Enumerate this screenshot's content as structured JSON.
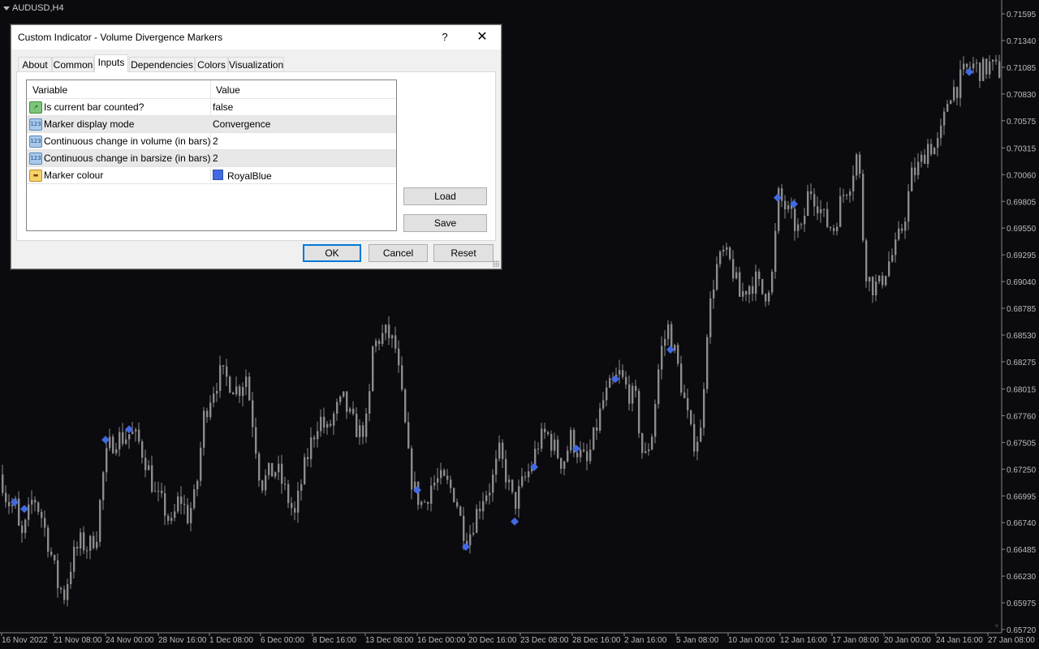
{
  "chart": {
    "symbol": "AUDUSD,H4",
    "background": "#0a0a0f",
    "candle_color": "#8c8c8c",
    "marker_color": "#4169E1",
    "price_axis": [
      "0.71595",
      "0.71340",
      "0.71085",
      "0.70830",
      "0.70575",
      "0.70315",
      "0.70060",
      "0.69805",
      "0.69550",
      "0.69295",
      "0.69040",
      "0.68785",
      "0.68530",
      "0.68275",
      "0.68015",
      "0.67760",
      "0.67505",
      "0.67250",
      "0.66995",
      "0.66740",
      "0.66485",
      "0.66230",
      "0.65975",
      "0.65720"
    ],
    "time_axis": [
      "16 Nov 2022",
      "21 Nov 08:00",
      "24 Nov 00:00",
      "28 Nov 16:00",
      "1 Dec 08:00",
      "6 Dec 00:00",
      "8 Dec 16:00",
      "13 Dec 08:00",
      "16 Dec 00:00",
      "20 Dec 16:00",
      "23 Dec 08:00",
      "28 Dec 16:00",
      "2 Jan 16:00",
      "5 Jan 08:00",
      "10 Jan 00:00",
      "12 Jan 16:00",
      "17 Jan 08:00",
      "20 Jan 00:00",
      "24 Jan 16:00",
      "27 Jan 08:00"
    ],
    "ylim": [
      0.6572,
      0.7172
    ],
    "close_path": [
      [
        0,
        0.672
      ],
      [
        6,
        0.67
      ],
      [
        12,
        0.669
      ],
      [
        18,
        0.669
      ],
      [
        24,
        0.6655
      ],
      [
        30,
        0.667
      ],
      [
        40,
        0.67
      ],
      [
        50,
        0.668
      ],
      [
        60,
        0.665
      ],
      [
        70,
        0.6615
      ],
      [
        78,
        0.6605
      ],
      [
        88,
        0.664
      ],
      [
        98,
        0.6655
      ],
      [
        108,
        0.665
      ],
      [
        118,
        0.6665
      ],
      [
        126,
        0.672
      ],
      [
        132,
        0.6745
      ],
      [
        142,
        0.6755
      ],
      [
        152,
        0.6755
      ],
      [
        160,
        0.676
      ],
      [
        170,
        0.675
      ],
      [
        180,
        0.673
      ],
      [
        190,
        0.67
      ],
      [
        200,
        0.669
      ],
      [
        210,
        0.667
      ],
      [
        220,
        0.67
      ],
      [
        230,
        0.668
      ],
      [
        240,
        0.67
      ],
      [
        250,
        0.6775
      ],
      [
        260,
        0.68
      ],
      [
        270,
        0.6815
      ],
      [
        280,
        0.681
      ],
      [
        292,
        0.68
      ],
      [
        302,
        0.6815
      ],
      [
        312,
        0.676
      ],
      [
        320,
        0.671
      ],
      [
        330,
        0.672
      ],
      [
        340,
        0.6725
      ],
      [
        352,
        0.67
      ],
      [
        362,
        0.668
      ],
      [
        372,
        0.672
      ],
      [
        382,
        0.675
      ],
      [
        392,
        0.6775
      ],
      [
        402,
        0.676
      ],
      [
        412,
        0.678
      ],
      [
        422,
        0.679
      ],
      [
        432,
        0.677
      ],
      [
        442,
        0.676
      ],
      [
        452,
        0.677
      ],
      [
        458,
        0.684
      ],
      [
        466,
        0.685
      ],
      [
        476,
        0.6855
      ],
      [
        486,
        0.684
      ],
      [
        496,
        0.678
      ],
      [
        504,
        0.672
      ],
      [
        512,
        0.67
      ],
      [
        520,
        0.669
      ],
      [
        530,
        0.671
      ],
      [
        540,
        0.6715
      ],
      [
        550,
        0.671
      ],
      [
        560,
        0.67
      ],
      [
        568,
        0.667
      ],
      [
        576,
        0.666
      ],
      [
        584,
        0.668
      ],
      [
        594,
        0.67
      ],
      [
        604,
        0.671
      ],
      [
        614,
        0.674
      ],
      [
        622,
        0.672
      ],
      [
        632,
        0.669
      ],
      [
        642,
        0.671
      ],
      [
        652,
        0.6725
      ],
      [
        662,
        0.675
      ],
      [
        672,
        0.676
      ],
      [
        682,
        0.6745
      ],
      [
        692,
        0.673
      ],
      [
        702,
        0.6755
      ],
      [
        712,
        0.674
      ],
      [
        722,
        0.673
      ],
      [
        732,
        0.676
      ],
      [
        742,
        0.679
      ],
      [
        752,
        0.6805
      ],
      [
        762,
        0.6815
      ],
      [
        772,
        0.68
      ],
      [
        782,
        0.679
      ],
      [
        792,
        0.673
      ],
      [
        802,
        0.676
      ],
      [
        812,
        0.6835
      ],
      [
        822,
        0.686
      ],
      [
        832,
        0.683
      ],
      [
        842,
        0.679
      ],
      [
        852,
        0.675
      ],
      [
        862,
        0.676
      ],
      [
        870,
        0.686
      ],
      [
        880,
        0.6915
      ],
      [
        890,
        0.693
      ],
      [
        900,
        0.692
      ],
      [
        910,
        0.689
      ],
      [
        920,
        0.69
      ],
      [
        930,
        0.6905
      ],
      [
        940,
        0.689
      ],
      [
        950,
        0.691
      ],
      [
        958,
        0.6985
      ],
      [
        966,
        0.6975
      ],
      [
        976,
        0.696
      ],
      [
        986,
        0.695
      ],
      [
        996,
        0.6995
      ],
      [
        1006,
        0.698
      ],
      [
        1016,
        0.696
      ],
      [
        1026,
        0.6955
      ],
      [
        1036,
        0.6985
      ],
      [
        1046,
        0.7
      ],
      [
        1056,
        0.703
      ],
      [
        1064,
        0.692
      ],
      [
        1072,
        0.69
      ],
      [
        1082,
        0.69
      ],
      [
        1092,
        0.692
      ],
      [
        1102,
        0.6935
      ],
      [
        1112,
        0.696
      ],
      [
        1122,
        0.7005
      ],
      [
        1132,
        0.7015
      ],
      [
        1142,
        0.7035
      ],
      [
        1152,
        0.703
      ],
      [
        1160,
        0.705
      ],
      [
        1168,
        0.7085
      ],
      [
        1178,
        0.709
      ],
      [
        1188,
        0.7105
      ],
      [
        1198,
        0.711
      ],
      [
        1208,
        0.7105
      ],
      [
        1218,
        0.711
      ],
      [
        1228,
        0.7105
      ]
    ],
    "markers": [
      [
        18,
        0.66935
      ],
      [
        30,
        0.6687
      ],
      [
        130,
        0.6753
      ],
      [
        159,
        0.6763
      ],
      [
        514,
        0.6705
      ],
      [
        574,
        0.6651
      ],
      [
        634,
        0.6675
      ],
      [
        658,
        0.6727
      ],
      [
        710,
        0.67445
      ],
      [
        758,
        0.6811
      ],
      [
        826,
        0.6839
      ],
      [
        958,
        0.6984
      ],
      [
        978,
        0.6978
      ],
      [
        1194,
        0.7104
      ]
    ]
  },
  "dialog": {
    "title": "Custom Indicator - Volume Divergence Markers",
    "help_label": "?",
    "close_label": "✕",
    "tabs": [
      "About",
      "Common",
      "Inputs",
      "Dependencies",
      "Colors",
      "Visualization"
    ],
    "active_tab": "Inputs",
    "grid": {
      "col_variable": "Variable",
      "col_value": "Value",
      "rows": [
        {
          "variable": "Is current bar counted?",
          "value": "false",
          "icon": "bool-icon"
        },
        {
          "variable": "Marker display mode",
          "value": "Convergence",
          "icon": "enum-icon"
        },
        {
          "variable": "Continuous change in volume (in bars)",
          "value": "2",
          "icon": "int-icon"
        },
        {
          "variable": "Continuous change in barsize (in bars)",
          "value": "2",
          "icon": "int-icon"
        },
        {
          "variable": "Marker colour",
          "value": "RoyalBlue",
          "icon": "color-icon",
          "swatch": "#4169E1"
        }
      ]
    },
    "load_label": "Load",
    "save_label": "Save",
    "ok_label": "OK",
    "cancel_label": "Cancel",
    "reset_label": "Reset"
  }
}
